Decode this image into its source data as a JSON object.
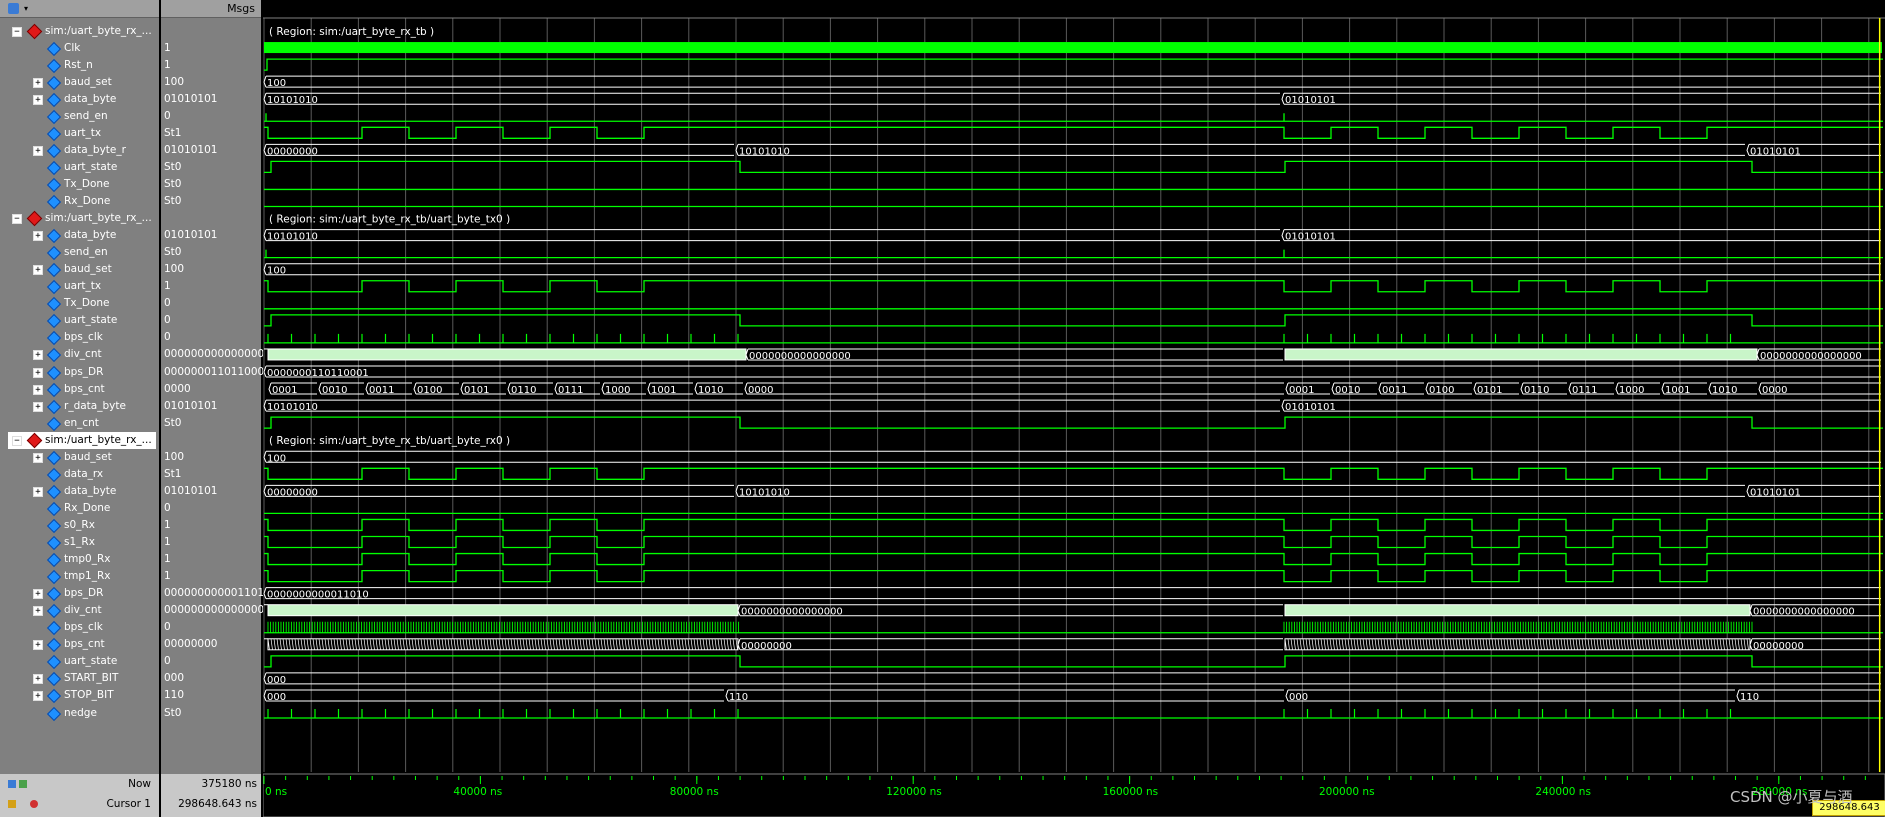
{
  "header": {
    "msgs_label": "Msgs"
  },
  "rows": [
    {
      "type": "group",
      "name": "sim:/uart_byte_rx_...",
      "value": "",
      "region": "( Region: sim:/uart_byte_rx_tb )"
    },
    {
      "type": "sig",
      "name": "Clk",
      "value": "1",
      "wave": "clk"
    },
    {
      "type": "sig",
      "name": "Rst_n",
      "value": "1",
      "wave": "high"
    },
    {
      "type": "bus",
      "name": "baud_set",
      "value": "100",
      "wave": "bus",
      "labels": [
        [
          "100",
          0
        ]
      ]
    },
    {
      "type": "bus",
      "name": "data_byte",
      "value": "01010101",
      "wave": "bus",
      "labels": [
        [
          "10101010",
          0
        ],
        [
          "01010101",
          1018
        ]
      ]
    },
    {
      "type": "sig",
      "name": "send_en",
      "value": "0",
      "wave": "low_pulse"
    },
    {
      "type": "sig",
      "name": "uart_tx",
      "value": "St1",
      "wave": "uart"
    },
    {
      "type": "bus",
      "name": "data_byte_r",
      "value": "01010101",
      "wave": "bus",
      "labels": [
        [
          "00000000",
          0
        ],
        [
          "10101010",
          472
        ],
        [
          "01010101",
          1483
        ]
      ]
    },
    {
      "type": "sig",
      "name": "uart_state",
      "value": "St0",
      "wave": "state"
    },
    {
      "type": "sig",
      "name": "Tx_Done",
      "value": "St0",
      "wave": "low"
    },
    {
      "type": "sig",
      "name": "Rx_Done",
      "value": "St0",
      "wave": "low"
    },
    {
      "type": "group",
      "name": "sim:/uart_byte_rx_...",
      "value": "",
      "region": "( Region: sim:/uart_byte_rx_tb/uart_byte_tx0 )"
    },
    {
      "type": "bus",
      "name": "data_byte",
      "value": "01010101",
      "wave": "bus",
      "labels": [
        [
          "10101010",
          0
        ],
        [
          "01010101",
          1018
        ]
      ]
    },
    {
      "type": "sig",
      "name": "send_en",
      "value": "St0",
      "wave": "low_pulse"
    },
    {
      "type": "bus",
      "name": "baud_set",
      "value": "100",
      "wave": "bus",
      "labels": [
        [
          "100",
          0
        ]
      ]
    },
    {
      "type": "sig",
      "name": "uart_tx",
      "value": "1",
      "wave": "uart"
    },
    {
      "type": "sig",
      "name": "Tx_Done",
      "value": "0",
      "wave": "low"
    },
    {
      "type": "sig",
      "name": "uart_state",
      "value": "0",
      "wave": "state"
    },
    {
      "type": "sig",
      "name": "bps_clk",
      "value": "0",
      "wave": "ticks"
    },
    {
      "type": "bus",
      "name": "div_cnt",
      "value": "0000000000000000",
      "wave": "dense",
      "labels": [
        [
          "0000000000000000",
          482
        ],
        [
          "0000000000000000",
          1493
        ]
      ]
    },
    {
      "type": "bus",
      "name": "bps_DR",
      "value": "0000000110110001",
      "wave": "bus",
      "labels": [
        [
          "0000000110110001",
          0
        ]
      ]
    },
    {
      "type": "bus",
      "name": "bps_cnt",
      "value": "0000",
      "wave": "bus",
      "labels": [
        [
          "0001",
          5
        ],
        [
          "0010",
          55
        ],
        [
          "0011",
          102
        ],
        [
          "0100",
          150
        ],
        [
          "0101",
          197
        ],
        [
          "0110",
          244
        ],
        [
          "0111",
          291
        ],
        [
          "1000",
          338
        ],
        [
          "1001",
          384
        ],
        [
          "1010",
          431
        ],
        [
          "0000",
          481
        ],
        [
          "0001",
          1022
        ],
        [
          "0010",
          1068
        ],
        [
          "0011",
          1115
        ],
        [
          "0100",
          1162
        ],
        [
          "0101",
          1210
        ],
        [
          "0110",
          1257
        ],
        [
          "0111",
          1305
        ],
        [
          "1000",
          1352
        ],
        [
          "1001",
          1398
        ],
        [
          "1010",
          1445
        ],
        [
          "0000",
          1495
        ]
      ]
    },
    {
      "type": "bus",
      "name": "r_data_byte",
      "value": "01010101",
      "wave": "bus",
      "labels": [
        [
          "10101010",
          0
        ],
        [
          "01010101",
          1018
        ]
      ]
    },
    {
      "type": "sig",
      "name": "en_cnt",
      "value": "St0",
      "wave": "state"
    },
    {
      "type": "group",
      "name": "sim:/uart_byte_rx_...",
      "value": "",
      "region": "( Region: sim:/uart_byte_rx_tb/uart_byte_rx0 )"
    },
    {
      "type": "bus",
      "name": "baud_set",
      "value": "100",
      "wave": "bus",
      "labels": [
        [
          "100",
          0
        ]
      ]
    },
    {
      "type": "sig",
      "name": "data_rx",
      "value": "St1",
      "wave": "uart"
    },
    {
      "type": "bus",
      "name": "data_byte",
      "value": "01010101",
      "wave": "bus",
      "labels": [
        [
          "00000000",
          0
        ],
        [
          "10101010",
          472
        ],
        [
          "01010101",
          1483
        ]
      ]
    },
    {
      "type": "sig",
      "name": "Rx_Done",
      "value": "0",
      "wave": "low"
    },
    {
      "type": "sig",
      "name": "s0_Rx",
      "value": "1",
      "wave": "uart"
    },
    {
      "type": "sig",
      "name": "s1_Rx",
      "value": "1",
      "wave": "uart"
    },
    {
      "type": "sig",
      "name": "tmp0_Rx",
      "value": "1",
      "wave": "uart"
    },
    {
      "type": "sig",
      "name": "tmp1_Rx",
      "value": "1",
      "wave": "uart"
    },
    {
      "type": "bus",
      "name": "bps_DR",
      "value": "0000000000011010",
      "wave": "bus",
      "labels": [
        [
          "0000000000011010",
          0
        ]
      ]
    },
    {
      "type": "bus",
      "name": "div_cnt",
      "value": "0000000000000000",
      "wave": "dense",
      "labels": [
        [
          "0000000000000000",
          474
        ],
        [
          "0000000000000000",
          1486
        ]
      ]
    },
    {
      "type": "sig",
      "name": "bps_clk",
      "value": "0",
      "wave": "fastticks"
    },
    {
      "type": "bus",
      "name": "bps_cnt",
      "value": "00000000",
      "wave": "densebus",
      "labels": [
        [
          "00000000",
          474
        ],
        [
          "00000000",
          1486
        ]
      ]
    },
    {
      "type": "sig",
      "name": "uart_state",
      "value": "0",
      "wave": "state"
    },
    {
      "type": "bus",
      "name": "START_BIT",
      "value": "000",
      "wave": "bus",
      "labels": [
        [
          "000",
          0
        ]
      ]
    },
    {
      "type": "bus",
      "name": "STOP_BIT",
      "value": "110",
      "wave": "bus",
      "labels": [
        [
          "000",
          0
        ],
        [
          "110",
          462
        ],
        [
          "000",
          1022
        ],
        [
          "110",
          1473
        ]
      ]
    },
    {
      "type": "sig",
      "name": "nedge",
      "value": "St0",
      "wave": "ticks"
    }
  ],
  "status": {
    "now_label": "Now",
    "now_value": "375180 ns",
    "cursor_label": "Cursor 1",
    "cursor_value": "298648.643 ns",
    "cursor_box": "298648.643 ns"
  },
  "timeline": {
    "ticks": [
      "0 ns",
      "40000 ns",
      "80000 ns",
      "120000 ns",
      "160000 ns",
      "200000 ns",
      "240000 ns",
      "280000 ns"
    ]
  },
  "watermark": "CSDN @小夏与酒",
  "colors": {
    "wave": "#00ff00",
    "bus": "#ffffff",
    "grid": "#5a5a5a",
    "cursor": "#ffff00"
  }
}
